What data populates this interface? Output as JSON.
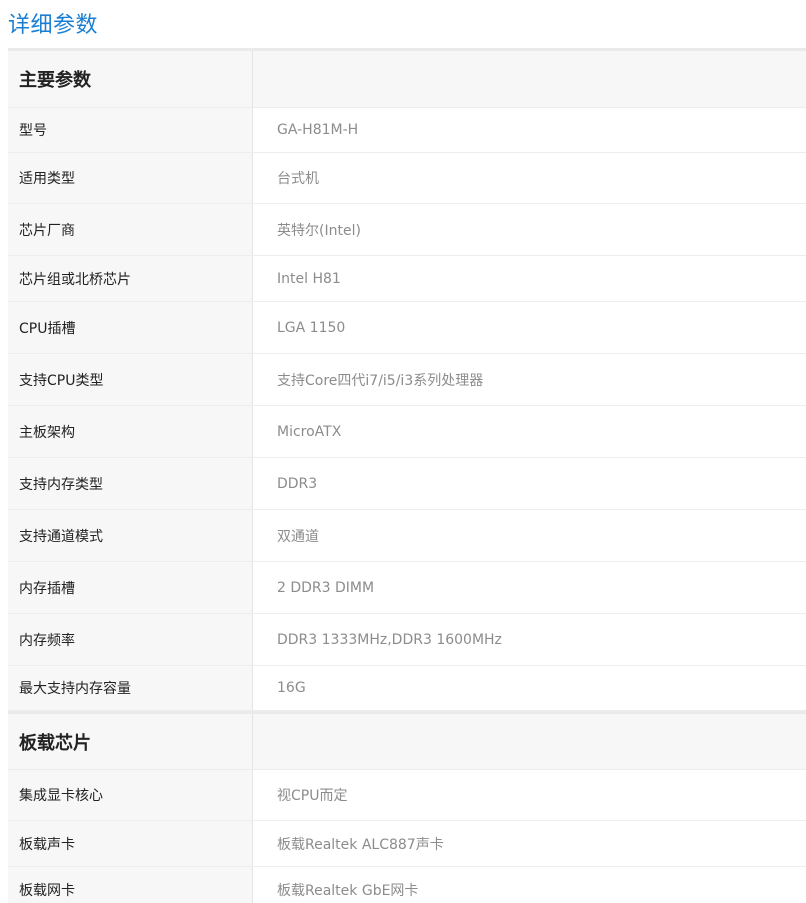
{
  "title": "详细参数",
  "sections": [
    {
      "name": "主要参数",
      "rows": [
        {
          "key": "型号",
          "value": "GA-H81M-H"
        },
        {
          "key": "适用类型",
          "value": "台式机"
        },
        {
          "key": "芯片厂商",
          "value": "英特尔(Intel)"
        },
        {
          "key": "芯片组或北桥芯片",
          "value": "Intel H81"
        },
        {
          "key": "CPU插槽",
          "value": "LGA 1150"
        },
        {
          "key": "支持CPU类型",
          "value": "支持Core四代i7/i5/i3系列处理器"
        },
        {
          "key": "主板架构",
          "value": "MicroATX"
        },
        {
          "key": "支持内存类型",
          "value": "DDR3"
        },
        {
          "key": "支持通道模式",
          "value": "双通道"
        },
        {
          "key": "内存插槽",
          "value": "2 DDR3 DIMM"
        },
        {
          "key": "内存频率",
          "value": "DDR3 1333MHz,DDR3 1600MHz"
        },
        {
          "key": "最大支持内存容量",
          "value": "16G"
        }
      ]
    },
    {
      "name": "板载芯片",
      "rows": [
        {
          "key": "集成显卡核心",
          "value": "视CPU而定"
        },
        {
          "key": "板载声卡",
          "value": "板载Realtek ALC887声卡"
        },
        {
          "key": "板载网卡",
          "value": "板载Realtek GbE网卡"
        }
      ]
    }
  ]
}
